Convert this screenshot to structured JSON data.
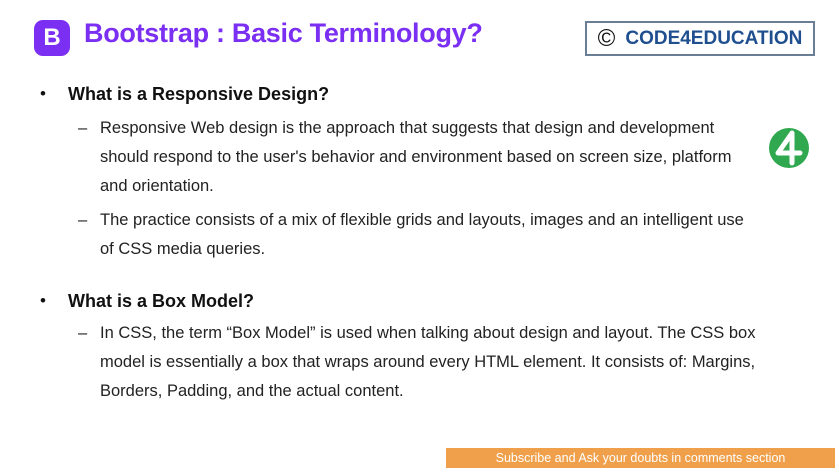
{
  "header": {
    "logo_letter": "B",
    "title": "Bootstrap : Basic Terminology?",
    "brand_copyright": "©",
    "brand_name": "CODE4EDUCATION"
  },
  "sections": [
    {
      "heading": "What is a Responsive Design?",
      "points": [
        "Responsive Web design is the approach that suggests that design and development should respond to the user's behavior and environment based on screen size, platform and orientation.",
        "The practice consists of a mix of flexible grids and layouts, images and an intelligent use of CSS media queries."
      ]
    },
    {
      "heading": "What is a Box Model?",
      "points": [
        "In CSS, the term “Box Model” is used when talking about design and layout. The CSS box model is essentially a box that wraps around every HTML element. It consists of: Margins, Borders, Padding, and the actual content."
      ]
    }
  ],
  "bullet_symbol": "•",
  "dash_symbol": "–",
  "footer": {
    "text": "Subscribe and Ask your doubts in comments section"
  },
  "colors": {
    "accent": "#7b2ff2",
    "brand_text": "#1f4f8f",
    "footer_bg": "#f0a04b",
    "side_logo": "#2fa84f"
  },
  "icons": {
    "side_logo": "code4-logo-icon"
  }
}
